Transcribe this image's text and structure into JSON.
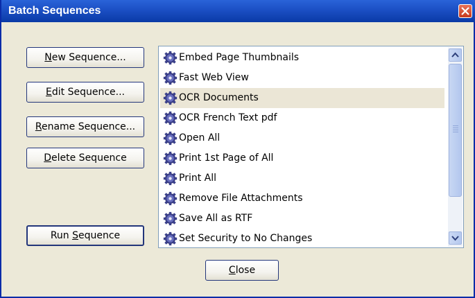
{
  "window": {
    "title": "Batch Sequences",
    "close_icon": "close-x-icon"
  },
  "buttons": {
    "new_sequence": {
      "underline": "N",
      "rest": "ew Sequence..."
    },
    "edit_sequence": {
      "underline": "E",
      "rest": "dit Sequence..."
    },
    "rename_sequence": {
      "underline": "R",
      "rest": "ename Sequence..."
    },
    "delete_sequence": {
      "underline": "D",
      "rest": "elete Sequence"
    },
    "run_sequence": {
      "pre": "Run ",
      "underline": "S",
      "rest": "equence"
    },
    "close": {
      "underline": "C",
      "rest": "lose"
    }
  },
  "sequences": {
    "item_icon": "gear-icon",
    "selected_index": 2,
    "items": [
      "Embed Page Thumbnails",
      "Fast Web View",
      "OCR Documents",
      "OCR French Text pdf",
      "Open All",
      "Print 1st Page of All",
      "Print All",
      "Remove File Attachments",
      "Save All as RTF",
      "Set Security to No Changes"
    ]
  },
  "colors": {
    "titlebar": "#1b4fc4",
    "dialog_bg": "#ece9d8",
    "selection": "#ebe6d6",
    "button_border": "#22357a"
  }
}
